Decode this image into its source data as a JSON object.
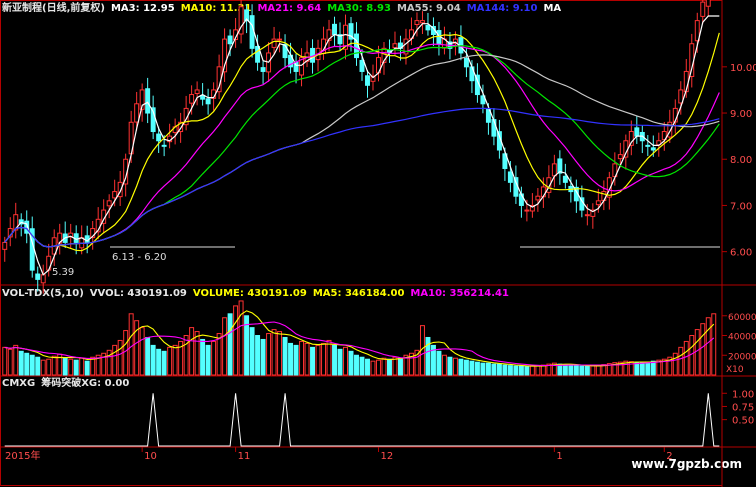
{
  "price_legend": {
    "title": "新亚制程(日线,前复权)",
    "ma3": "MA3: 12.95",
    "ma10": "MA10: 11.31",
    "ma21": "MA21: 9.64",
    "ma30": "MA30: 8.93",
    "ma55": "MA55: 9.04",
    "ma144": "MA144: 9.10",
    "ma_cut": "MA"
  },
  "vol_legend": {
    "title": "VOL-TDX(5,10)",
    "vvol": "VVOL: 430191.09",
    "volume": "VOLUME: 430191.09",
    "ma5": "MA5: 346184.00",
    "ma10": "MA10: 356214.41"
  },
  "cmxg_legend": {
    "title": "CMXG",
    "xg": "筹码突破XG: 0.00"
  },
  "annotations": {
    "low_label": "5.39",
    "range_label": "6.13 - 6.20"
  },
  "axes": {
    "price_ticks": [
      "10.00",
      "9.00",
      "8.00",
      "7.00",
      "6.00"
    ],
    "volume_ticks": [
      "60000",
      "40000",
      "20000"
    ],
    "volume_unit": "X10",
    "cmxg_ticks": [
      "1.00",
      "0.75",
      "0.50"
    ],
    "date_labels": [
      "2015年",
      "10",
      "11",
      "12",
      "1",
      "2"
    ]
  },
  "watermark": "www.7gpzb.com",
  "colors": {
    "up": "#ff3232",
    "down": "#54ffff",
    "ma3": "#ffffff",
    "ma10": "#ffff00",
    "ma21": "#ff00ff",
    "ma30": "#00e600",
    "ma55": "#c8c8c8",
    "ma144": "#3232ff",
    "axis": "#b40000"
  },
  "chart_data": [
    {
      "type": "candlestick",
      "title": "新亚制程(日线,前复权)",
      "ylim": [
        5.3,
        11.1
      ],
      "yticks": [
        6.0,
        7.0,
        8.0,
        9.0,
        10.0
      ],
      "close": [
        6.2,
        6.5,
        6.8,
        6.6,
        6.4,
        5.6,
        5.4,
        5.5,
        5.9,
        6.3,
        6.4,
        6.2,
        6.4,
        6.2,
        6.3,
        6.2,
        6.5,
        6.7,
        6.9,
        7.1,
        7.3,
        7.5,
        8.0,
        8.8,
        9.2,
        9.5,
        9.0,
        8.6,
        8.4,
        8.3,
        8.5,
        8.7,
        8.8,
        9.1,
        9.4,
        9.5,
        9.3,
        9.2,
        9.5,
        10.0,
        10.6,
        10.5,
        10.8,
        11.3,
        11.0,
        10.4,
        10.1,
        9.9,
        10.3,
        10.6,
        10.6,
        10.2,
        10.0,
        9.9,
        10.2,
        10.3,
        10.1,
        10.4,
        10.6,
        10.8,
        10.7,
        10.5,
        10.9,
        10.6,
        10.2,
        9.9,
        9.6,
        9.8,
        10.2,
        10.4,
        10.3,
        10.5,
        10.4,
        10.6,
        10.8,
        11.0,
        11.0,
        10.8,
        10.7,
        10.5,
        10.6,
        10.4,
        10.6,
        10.3,
        10.0,
        9.7,
        9.4,
        9.2,
        8.8,
        8.5,
        8.2,
        7.8,
        7.5,
        7.2,
        7.0,
        6.9,
        7.0,
        7.2,
        7.4,
        7.6,
        7.9,
        7.7,
        7.5,
        7.3,
        7.1,
        6.9,
        6.8,
        6.9,
        7.1,
        7.3,
        7.6,
        7.9,
        8.1,
        8.4,
        8.6,
        8.5,
        8.4,
        8.3,
        8.2,
        8.4,
        8.6,
        8.8,
        9.1,
        9.5,
        9.9,
        10.5,
        11.0,
        11.4,
        11.8,
        12.4,
        12.95
      ],
      "volume": [
        28000,
        26000,
        30000,
        24000,
        22000,
        20000,
        18000,
        15000,
        16000,
        19000,
        21000,
        17000,
        16000,
        15000,
        17000,
        14000,
        18000,
        20000,
        22000,
        25000,
        30000,
        35000,
        45000,
        62000,
        55000,
        48000,
        38000,
        30000,
        26000,
        24000,
        28000,
        30000,
        34000,
        40000,
        48000,
        44000,
        36000,
        30000,
        34000,
        42000,
        58000,
        62000,
        70000,
        75000,
        60000,
        48000,
        40000,
        36000,
        42000,
        46000,
        44000,
        38000,
        32000,
        30000,
        34000,
        32000,
        28000,
        30000,
        32000,
        35000,
        30000,
        26000,
        28000,
        24000,
        20000,
        18000,
        16000,
        14000,
        15000,
        17000,
        16000,
        18000,
        17000,
        20000,
        22000,
        25000,
        50000,
        38000,
        30000,
        24000,
        20000,
        18000,
        17000,
        16000,
        15000,
        14000,
        13000,
        12000,
        12000,
        11000,
        11000,
        10000,
        9500,
        9000,
        9000,
        8500,
        9000,
        9500,
        10000,
        11000,
        12000,
        11000,
        10500,
        10000,
        9500,
        9000,
        8800,
        9200,
        9800,
        10500,
        11500,
        12500,
        13000,
        14000,
        13500,
        13000,
        12500,
        13000,
        14000,
        15000,
        16000,
        18000,
        22000,
        28000,
        34000,
        40000,
        46000,
        52000,
        58000,
        62000
      ],
      "series": [
        {
          "name": "MA3",
          "last": 12.95
        },
        {
          "name": "MA10",
          "last": 11.31
        },
        {
          "name": "MA21",
          "last": 9.64
        },
        {
          "name": "MA30",
          "last": 8.93
        },
        {
          "name": "MA55",
          "last": 9.04
        },
        {
          "name": "MA144",
          "last": 9.1
        }
      ],
      "annotations": [
        {
          "text": "5.39"
        },
        {
          "text": "6.13 - 6.20"
        }
      ]
    },
    {
      "type": "bar",
      "title": "VOL-TDX(5,10)",
      "ylim": [
        0,
        78000
      ],
      "yticks": [
        20000,
        40000,
        60000
      ],
      "unit": "X10",
      "series": [
        {
          "name": "MA5",
          "last": 346184.0
        },
        {
          "name": "MA10",
          "last": 356214.41
        }
      ]
    },
    {
      "type": "line",
      "title": "CMXG",
      "series_name": "筹码突破XG",
      "ylim": [
        0,
        1.1
      ],
      "yticks": [
        0.5,
        0.75,
        1.0
      ],
      "signal_bars": [
        27,
        42,
        51,
        128
      ],
      "last": 0.0
    }
  ]
}
